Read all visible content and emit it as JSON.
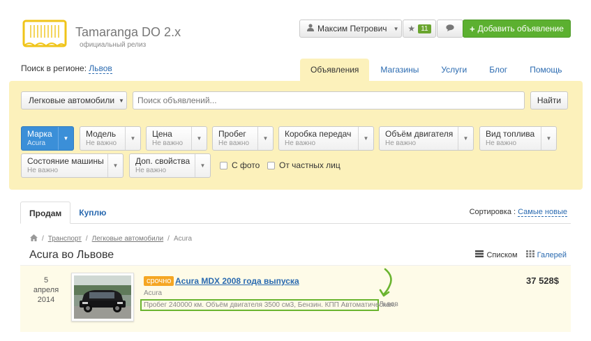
{
  "header": {
    "brand_title": "Tamaranga DO 2.x",
    "brand_subtitle": "официальный релиз",
    "user_name": "Максим Петрович",
    "favorites_count": "11",
    "add_button_label": "Добавить объявление"
  },
  "region": {
    "label": "Поиск в регионе:",
    "value": "Львов"
  },
  "nav_tabs": [
    "Объявления",
    "Магазины",
    "Услуги",
    "Блог",
    "Помощь"
  ],
  "search": {
    "category": "Легковые автомобили",
    "placeholder": "Поиск объявлений...",
    "button": "Найти"
  },
  "filters": [
    {
      "label": "Марка",
      "value": "Acura"
    },
    {
      "label": "Модель",
      "value": "Не важно"
    },
    {
      "label": "Цена",
      "value": "Не важно"
    },
    {
      "label": "Пробег",
      "value": "Не важно"
    },
    {
      "label": "Коробка передач",
      "value": "Не важно"
    },
    {
      "label": "Объём двигателя",
      "value": "Не важно"
    },
    {
      "label": "Вид топлива",
      "value": "Не важно"
    },
    {
      "label": "Состояние машины",
      "value": "Не важно"
    },
    {
      "label": "Доп. свойства",
      "value": "Не важно"
    }
  ],
  "checkboxes": [
    "С фото",
    "От частных лиц"
  ],
  "list_tabs": [
    "Продам",
    "Куплю"
  ],
  "sort": {
    "label": "Сортировка :",
    "value": "Самые новые"
  },
  "breadcrumbs": [
    "Транспорт",
    "Легковые автомобили",
    "Acura"
  ],
  "page_title": "Acura во Львове",
  "views": {
    "list": "Списком",
    "gallery": "Галерeй"
  },
  "listing": {
    "date_day": "5 апреля",
    "date_year": "2014",
    "badge": "срочно",
    "title": "Acura MDX 2008 года выпуска",
    "brand": "Acura",
    "description": "Пробег 240000 км. Объём двигателя 3500 см3, Бензин. КПП Автоматическая.",
    "city": "Львов",
    "price": "37 528$"
  },
  "colors": {
    "accent_green": "#5cb030",
    "panel_yellow": "#fcf1bb",
    "link_blue": "#2a6ab0",
    "active_filter": "#3b8fd8",
    "urgent_orange": "#f5a623",
    "highlight_green": "#6ab42f"
  }
}
